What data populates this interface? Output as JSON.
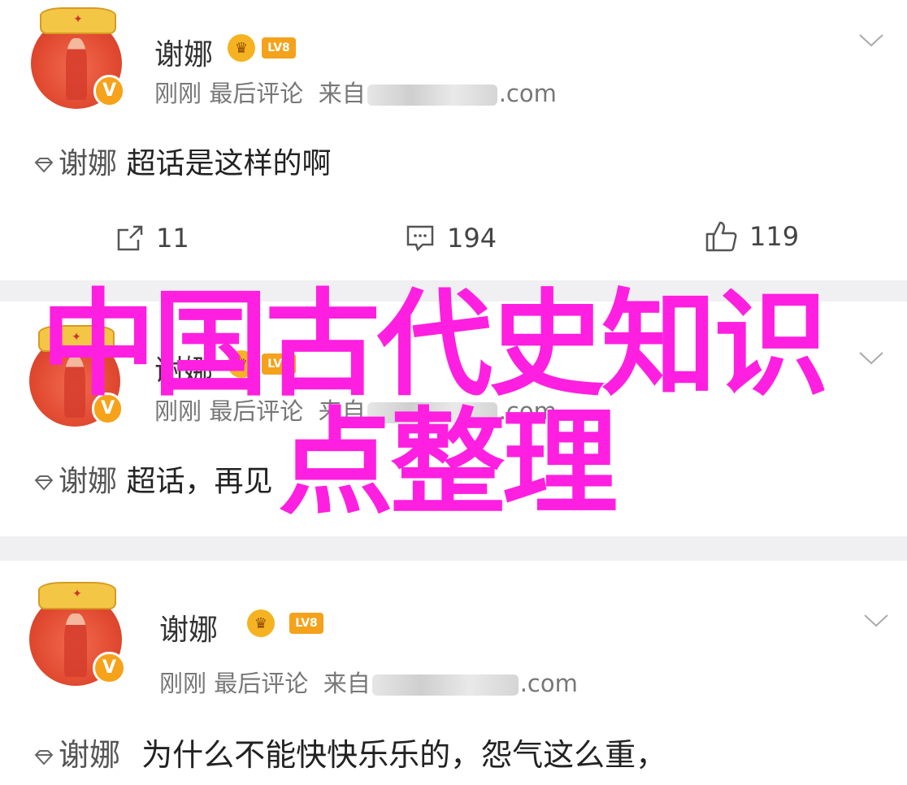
{
  "posts": [
    {
      "username": "谢娜",
      "level": "LV8",
      "meta_time": "刚刚",
      "meta_action": "最后评论",
      "meta_from": "来自",
      "meta_domain": ".com",
      "tag": "谢娜",
      "text": "超话是这样的啊",
      "reposts": "11",
      "comments": "194",
      "likes": "119"
    },
    {
      "username": "谢娜",
      "level": "LV8",
      "meta_time": "刚刚",
      "meta_action": "最后评论",
      "meta_from": "来自",
      "meta_domain": ".com",
      "tag": "谢娜",
      "text": "超话，再见"
    },
    {
      "username": "谢娜",
      "level": "LV8",
      "meta_time": "刚刚",
      "meta_action": "最后评论",
      "meta_from": "来自",
      "meta_domain": ".com",
      "tag": "谢娜",
      "text": "为什么不能快快乐乐的，怨气这么重，"
    }
  ],
  "overlay": {
    "line1": "中国古代史知识",
    "line2": "点整理"
  },
  "colors": {
    "overlay": "#ff1fe0",
    "badge": "#f4a21b",
    "divider": "#f0f0f2"
  }
}
